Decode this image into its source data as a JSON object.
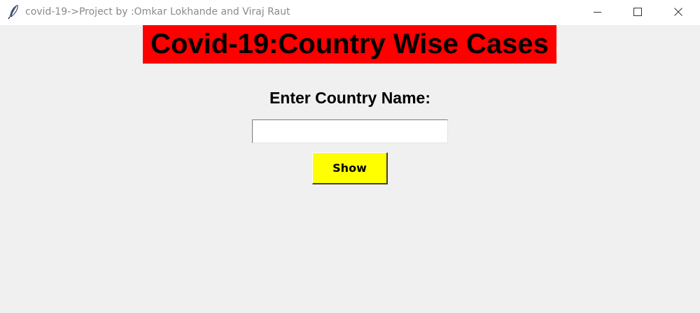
{
  "window": {
    "title": "covid-19->Project by :Omkar Lokhande and Viraj Raut",
    "app_icon": "feather-icon",
    "controls": [
      "minimize-icon",
      "maximize-icon",
      "close-icon"
    ]
  },
  "main": {
    "heading": "Covid-19:Country Wise Cases",
    "country_label": "Enter Country Name:",
    "country_input": {
      "value": "",
      "placeholder": ""
    },
    "show_button": "Show"
  },
  "colors": {
    "window_bg": "#f0f0f0",
    "heading_bg": "#ff0000",
    "button_bg": "#ffff00",
    "text": "#000000"
  }
}
